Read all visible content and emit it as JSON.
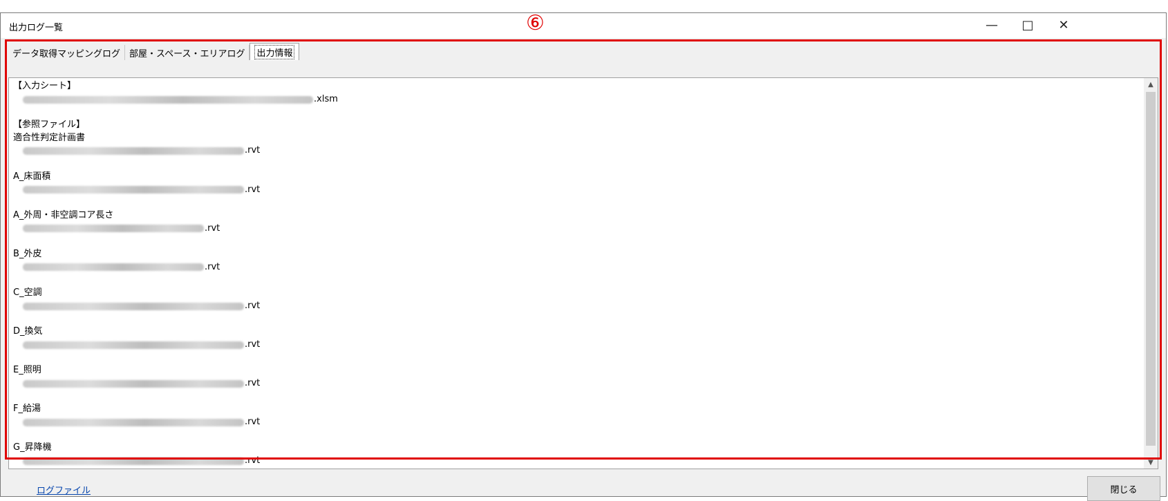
{
  "window": {
    "title": "出力ログ一覧",
    "minimize_icon": "minimize-icon",
    "maximize_icon": "maximize-icon",
    "close_icon": "close-icon"
  },
  "annotation": {
    "number": "⑥",
    "color": "#e00000"
  },
  "tabs": [
    {
      "label": "データ取得マッピングログ",
      "active": false
    },
    {
      "label": "部屋・スペース・エリアログ",
      "active": false
    },
    {
      "label": "出力情報",
      "active": true
    }
  ],
  "content": {
    "input_sheet": {
      "header": "【入力シート】",
      "path_suffix": ".xlsm"
    },
    "ref_files_header": "【参照ファイル】",
    "ref_files": [
      {
        "label": "適合性判定計画書",
        "path_suffix": ".rvt"
      },
      {
        "label": "A_床面積",
        "path_suffix": ".rvt"
      },
      {
        "label": "A_外周・非空調コア長さ",
        "path_suffix": ".rvt"
      },
      {
        "label": "B_外皮",
        "path_suffix": ".rvt"
      },
      {
        "label": "C_空調",
        "path_suffix": ".rvt"
      },
      {
        "label": "D_換気",
        "path_suffix": ".rvt"
      },
      {
        "label": "E_照明",
        "path_suffix": ".rvt"
      },
      {
        "label": "F_給湯",
        "path_suffix": ".rvt"
      },
      {
        "label": "G_昇降機",
        "path_suffix": ".rvt"
      }
    ]
  },
  "footer": {
    "log_file_link": "ログファイル",
    "close_button": "閉じる"
  }
}
